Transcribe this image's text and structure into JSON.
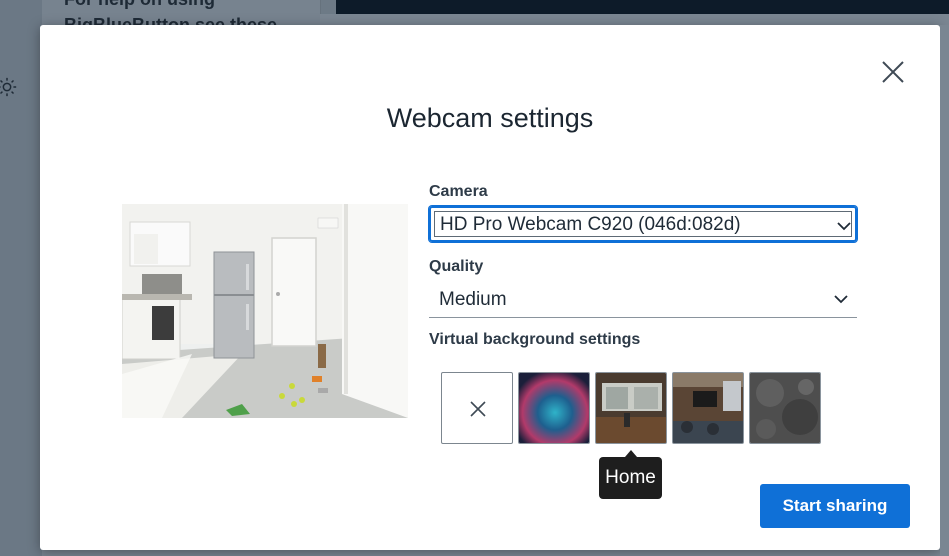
{
  "background": {
    "panel_text": "For help on using BigBlueButton see these"
  },
  "modal": {
    "title": "Webcam settings",
    "camera_label": "Camera",
    "camera_value": "HD Pro Webcam C920 (046d:082d)",
    "quality_label": "Quality",
    "quality_value": "Medium",
    "virtual_bg_label": "Virtual background settings",
    "virtual_backgrounds": [
      {
        "name": "none",
        "icon": "close-icon"
      },
      {
        "name": "blur"
      },
      {
        "name": "home"
      },
      {
        "name": "coworking"
      },
      {
        "name": "board"
      }
    ],
    "tooltip": "Home",
    "start_button": "Start sharing"
  },
  "colors": {
    "accent": "#0f70d7",
    "title": "#1b2631",
    "tooltip_bg": "#1e1e1e"
  }
}
